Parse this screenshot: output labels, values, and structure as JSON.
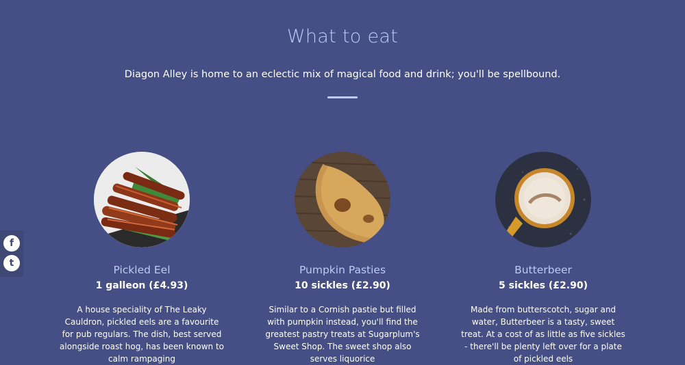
{
  "section": {
    "title": "What to eat",
    "subtitle": "Diagon Alley is home to an eclectic mix of magical food and drink; you'll be spellbound."
  },
  "items": [
    {
      "name": "Pickled Eel",
      "price": "1 galleon (£4.93)",
      "description": "A house speciality of The Leaky Cauldron, pickled eels are a favourite for pub regulars. The dish, best served alongside roast hog, has been known to calm rampaging"
    },
    {
      "name": "Pumpkin Pasties",
      "price": "10 sickles (£2.90)",
      "description": "Similar to a Cornish pastie but filled with pumpkin instead, you'll find the greatest pastry treats at Sugarplum's Sweet Shop. The sweet shop also serves liquorice"
    },
    {
      "name": "Butterbeer",
      "price": "5 sickles (£2.90)",
      "description": "Made from butterscotch, sugar and water, Butterbeer is a tasty, sweet treat. At a cost of as little as five sickles - there'll be plenty left over for a plate of pickled eels"
    }
  ],
  "social": {
    "icons": [
      "facebook-icon",
      "twitter-icon"
    ],
    "facebook_glyph": "f",
    "twitter_glyph": "t"
  },
  "colors": {
    "background": "#454f85",
    "accent": "#b7cdf2",
    "text": "#ffffff"
  }
}
